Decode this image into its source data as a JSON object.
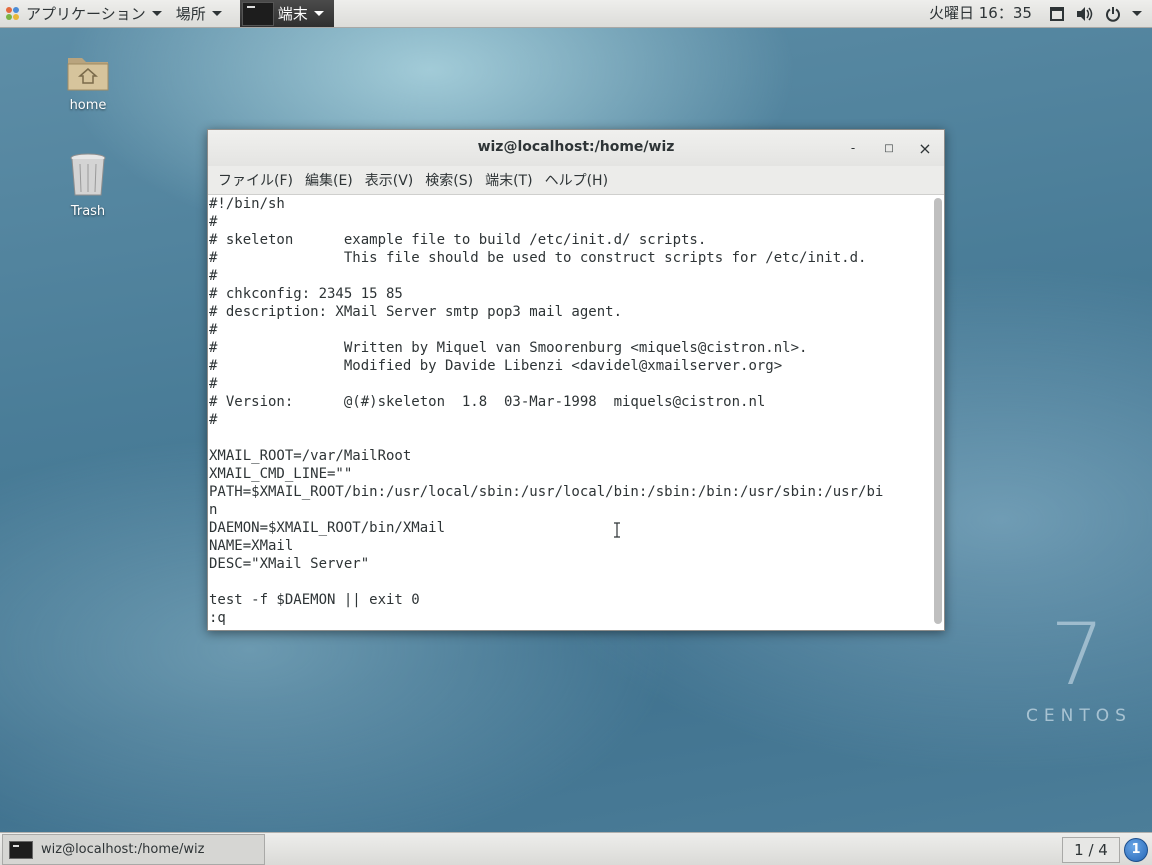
{
  "topbar": {
    "applications": "アプリケーション",
    "places": "場所",
    "terminal_task": "端末",
    "clock": "火曜日 16：35"
  },
  "icons": {
    "apps": "apps-icon",
    "screen": "window-icon",
    "volume": "volume-icon",
    "power": "power-icon"
  },
  "desktop": {
    "home_label": "home",
    "trash_label": "Trash",
    "watermark_number": "7",
    "watermark_text": "CENTOS"
  },
  "window": {
    "title": "wiz@localhost:/home/wiz",
    "minimize": "-",
    "maximize": "□",
    "close": "×",
    "menu": [
      "ファイル(F)",
      "編集(E)",
      "表示(V)",
      "検索(S)",
      "端末(T)",
      "ヘルプ(H)"
    ]
  },
  "terminal": {
    "lines": [
      "#!/bin/sh",
      "#",
      "# skeleton      example file to build /etc/init.d/ scripts.",
      "#               This file should be used to construct scripts for /etc/init.d.",
      "#",
      "# chkconfig: 2345 15 85",
      "# description: XMail Server smtp pop3 mail agent.",
      "#",
      "#               Written by Miquel van Smoorenburg <miquels@cistron.nl>.",
      "#               Modified by Davide Libenzi <davidel@xmailserver.org>",
      "#",
      "# Version:      @(#)skeleton  1.8  03-Mar-1998  miquels@cistron.nl",
      "#",
      "",
      "XMAIL_ROOT=/var/MailRoot",
      "XMAIL_CMD_LINE=\"\"",
      "PATH=$XMAIL_ROOT/bin:/usr/local/sbin:/usr/local/bin:/sbin:/bin:/usr/sbin:/usr/bi",
      "n",
      "DAEMON=$XMAIL_ROOT/bin/XMail",
      "NAME=XMail",
      "DESC=\"XMail Server\"",
      "",
      "test -f $DAEMON || exit 0",
      ":q"
    ]
  },
  "bottombar": {
    "task_label": "wiz@localhost:/home/wiz",
    "pager": "1 / 4",
    "notifications": "1"
  }
}
